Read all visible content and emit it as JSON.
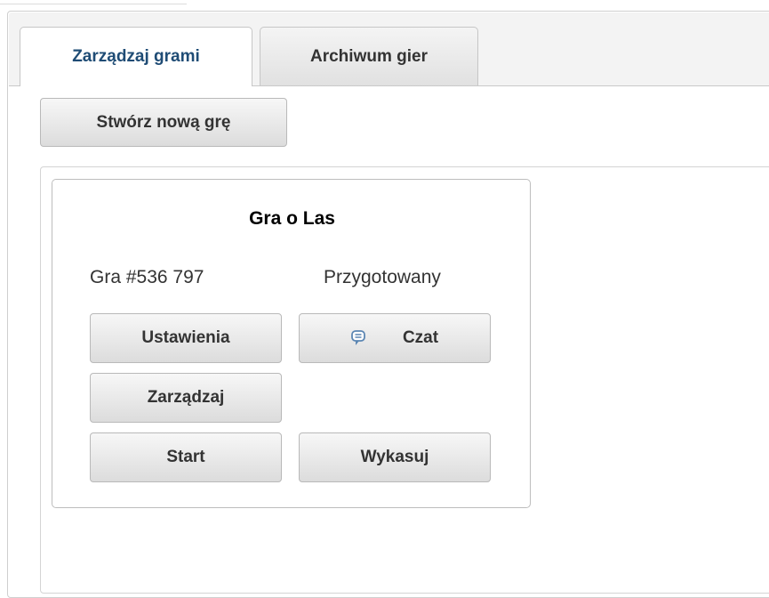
{
  "tabs": [
    {
      "label": "Zarządzaj grami",
      "active": true
    },
    {
      "label": "Archiwum gier",
      "active": false
    }
  ],
  "toolbar": {
    "create_label": "Stwórz nową grę"
  },
  "game": {
    "title": "Gra o Las",
    "id_text": "Gra #536 797",
    "status": "Przygotowany",
    "buttons": {
      "settings": "Ustawienia",
      "chat": "Czat",
      "manage": "Zarządzaj",
      "start": "Start",
      "delete": "Wykasuj"
    },
    "chat_icon": "chat-bubble-icon"
  },
  "colors": {
    "active_tab_text": "#1f4c75",
    "button_text": "#333333",
    "chat_icon": "#5b86b3"
  }
}
